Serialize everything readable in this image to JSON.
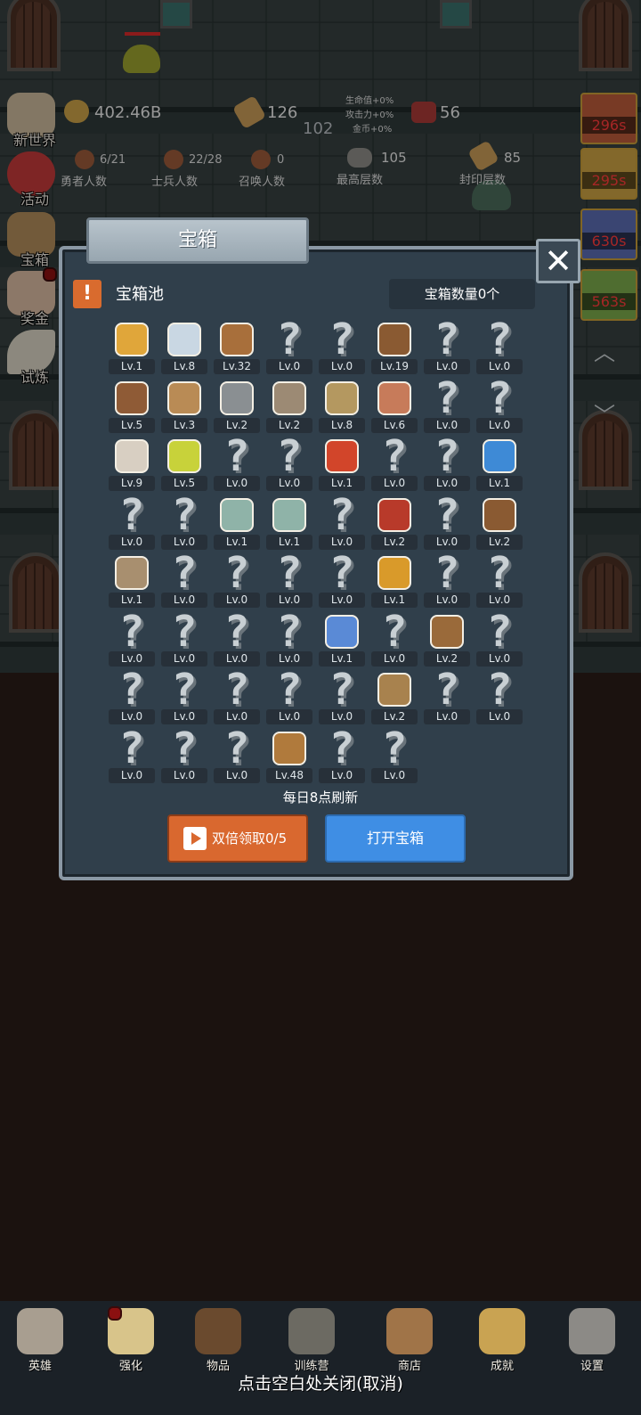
{
  "top_stats": {
    "gold": "402.46B",
    "scroll": "126",
    "meat": "56",
    "center_num": "102",
    "buffs": [
      "生命值+0%",
      "攻击力+0%",
      "金币+0%"
    ],
    "heroes": {
      "value": "6/21",
      "label": "勇者人数"
    },
    "soldiers": {
      "value": "22/28",
      "label": "士兵人数"
    },
    "summons": {
      "value": "0",
      "label": "召唤人数"
    },
    "max_floor": {
      "value": "105",
      "label": "最高层数"
    },
    "seal_floor": {
      "value": "85",
      "label": "封印层数"
    }
  },
  "left_menu": [
    {
      "label": "新世界",
      "icon": "map-scroll-icon"
    },
    {
      "label": "活动",
      "icon": "heart-icon"
    },
    {
      "label": "宝箱",
      "icon": "treasure-chest-icon"
    },
    {
      "label": "奖金",
      "icon": "envelope-icon"
    },
    {
      "label": "试炼",
      "icon": "feather-icon"
    }
  ],
  "right_timers": [
    "296s",
    "295s",
    "630s",
    "563s"
  ],
  "dialog": {
    "title": "宝箱",
    "close": "✕",
    "alert": "!",
    "pool_label": "宝箱池",
    "count_text": "宝箱数量0个",
    "refresh_text": "每日8点刷新",
    "ad_button": "双倍领取0/5",
    "open_button": "打开宝箱"
  },
  "items": [
    {
      "lv": "Lv.1",
      "icon": "crown-icon",
      "color": "#e0a63a"
    },
    {
      "lv": "Lv.8",
      "icon": "diamond-icon",
      "color": "#c9d7e3"
    },
    {
      "lv": "Lv.32",
      "icon": "wooden-sword-icon",
      "color": "#a86f3b"
    },
    {
      "lv": "Lv.0",
      "icon": "unknown-icon"
    },
    {
      "lv": "Lv.0",
      "icon": "unknown-icon"
    },
    {
      "lv": "Lv.19",
      "icon": "leather-armor-icon",
      "color": "#8a5a32"
    },
    {
      "lv": "Lv.0",
      "icon": "unknown-icon"
    },
    {
      "lv": "Lv.0",
      "icon": "unknown-icon"
    },
    {
      "lv": "Lv.5",
      "icon": "leather-helmet-icon",
      "color": "#8f5b36"
    },
    {
      "lv": "Lv.3",
      "icon": "dagger-icon",
      "color": "#b98b55"
    },
    {
      "lv": "Lv.2",
      "icon": "knight-helmet-icon",
      "color": "#8a8f92"
    },
    {
      "lv": "Lv.2",
      "icon": "hammer-icon",
      "color": "#9c8a74"
    },
    {
      "lv": "Lv.8",
      "icon": "great-helm-icon",
      "color": "#b49860"
    },
    {
      "lv": "Lv.6",
      "icon": "ham-icon",
      "color": "#c77b5a"
    },
    {
      "lv": "Lv.0",
      "icon": "unknown-icon"
    },
    {
      "lv": "Lv.0",
      "icon": "unknown-icon"
    },
    {
      "lv": "Lv.9",
      "icon": "flour-bowl-icon",
      "color": "#d8cfc2"
    },
    {
      "lv": "Lv.5",
      "icon": "yellow-potion-icon",
      "color": "#c8d23a"
    },
    {
      "lv": "Lv.0",
      "icon": "unknown-icon"
    },
    {
      "lv": "Lv.0",
      "icon": "unknown-icon"
    },
    {
      "lv": "Lv.1",
      "icon": "red-potion-icon",
      "color": "#d2452a"
    },
    {
      "lv": "Lv.0",
      "icon": "unknown-icon"
    },
    {
      "lv": "Lv.0",
      "icon": "unknown-icon"
    },
    {
      "lv": "Lv.1",
      "icon": "blue-potion-icon",
      "color": "#3e8ad6"
    },
    {
      "lv": "Lv.0",
      "icon": "unknown-icon"
    },
    {
      "lv": "Lv.0",
      "icon": "unknown-icon"
    },
    {
      "lv": "Lv.1",
      "icon": "empty-bottle-icon",
      "color": "#8fb3a8"
    },
    {
      "lv": "Lv.1",
      "icon": "empty-bottle-icon",
      "color": "#8fb3a8"
    },
    {
      "lv": "Lv.0",
      "icon": "unknown-icon"
    },
    {
      "lv": "Lv.2",
      "icon": "red-vial-icon",
      "color": "#b83a2a"
    },
    {
      "lv": "Lv.0",
      "icon": "unknown-icon"
    },
    {
      "lv": "Lv.2",
      "icon": "boot-icon",
      "color": "#8a5a32"
    },
    {
      "lv": "Lv.1",
      "icon": "shoe-icon",
      "color": "#a88f6f"
    },
    {
      "lv": "Lv.0",
      "icon": "unknown-icon"
    },
    {
      "lv": "Lv.0",
      "icon": "unknown-icon"
    },
    {
      "lv": "Lv.0",
      "icon": "unknown-icon"
    },
    {
      "lv": "Lv.0",
      "icon": "unknown-icon"
    },
    {
      "lv": "Lv.1",
      "icon": "torch-icon",
      "color": "#d99a2a"
    },
    {
      "lv": "Lv.0",
      "icon": "unknown-icon"
    },
    {
      "lv": "Lv.0",
      "icon": "unknown-icon"
    },
    {
      "lv": "Lv.0",
      "icon": "unknown-icon"
    },
    {
      "lv": "Lv.0",
      "icon": "unknown-icon"
    },
    {
      "lv": "Lv.0",
      "icon": "unknown-icon"
    },
    {
      "lv": "Lv.0",
      "icon": "unknown-icon"
    },
    {
      "lv": "Lv.1",
      "icon": "magic-staff-icon",
      "color": "#5a8ad6"
    },
    {
      "lv": "Lv.0",
      "icon": "unknown-icon"
    },
    {
      "lv": "Lv.2",
      "icon": "backpack-icon",
      "color": "#9a6a3a"
    },
    {
      "lv": "Lv.0",
      "icon": "unknown-icon"
    },
    {
      "lv": "Lv.0",
      "icon": "unknown-icon"
    },
    {
      "lv": "Lv.0",
      "icon": "unknown-icon"
    },
    {
      "lv": "Lv.0",
      "icon": "unknown-icon"
    },
    {
      "lv": "Lv.0",
      "icon": "unknown-icon"
    },
    {
      "lv": "Lv.0",
      "icon": "unknown-icon"
    },
    {
      "lv": "Lv.2",
      "icon": "bow-icon",
      "color": "#a8824e"
    },
    {
      "lv": "Lv.0",
      "icon": "unknown-icon"
    },
    {
      "lv": "Lv.0",
      "icon": "unknown-icon"
    },
    {
      "lv": "Lv.0",
      "icon": "unknown-icon"
    },
    {
      "lv": "Lv.0",
      "icon": "unknown-icon"
    },
    {
      "lv": "Lv.0",
      "icon": "unknown-icon"
    },
    {
      "lv": "Lv.48",
      "icon": "beer-mug-icon",
      "color": "#b07a3c"
    },
    {
      "lv": "Lv.0",
      "icon": "unknown-icon"
    },
    {
      "lv": "Lv.0",
      "icon": "unknown-icon"
    }
  ],
  "bottom_nav": [
    {
      "label": "英雄",
      "icon": "skull-icon",
      "color": "#a89e90"
    },
    {
      "label": "强化",
      "icon": "candle-icon",
      "color": "#d8c48a"
    },
    {
      "label": "物品",
      "icon": "book-icon",
      "color": "#6a4a2e"
    },
    {
      "label": "训练营",
      "icon": "lantern-icon",
      "color": "#6c6a62"
    },
    {
      "label": "商店",
      "icon": "beer-mug-icon",
      "color": "#a07448"
    },
    {
      "label": "成就",
      "icon": "key-icon",
      "color": "#c9a352"
    },
    {
      "label": "设置",
      "icon": "gear-icon",
      "color": "#8c8a86"
    }
  ],
  "close_hint": "点击空白处关闭(取消)"
}
